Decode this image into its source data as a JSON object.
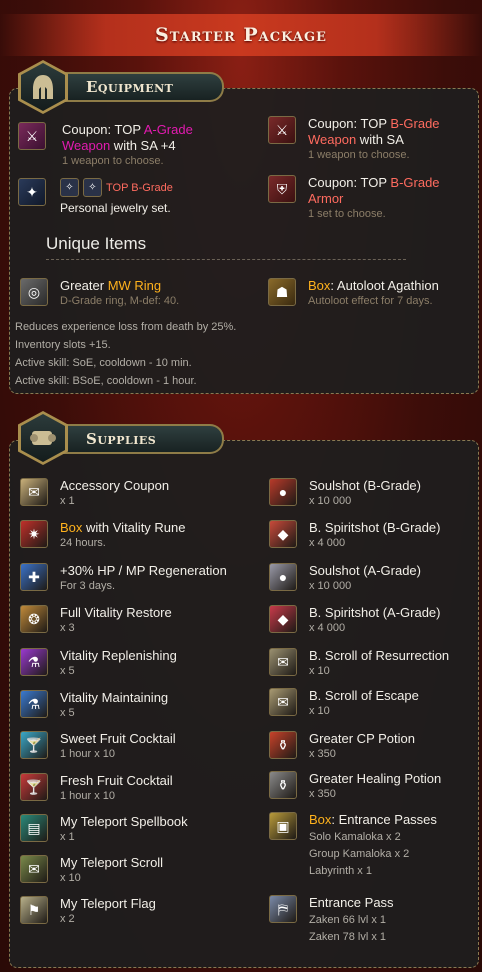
{
  "title": "Starter Package",
  "equipment": {
    "heading": "Equipment",
    "items": [
      {
        "line1_a": "Coupon: TOP ",
        "line1_b": "A-Grade",
        "line2_a": "Weapon",
        "line2_b": " with SA +4",
        "sub": "1 weapon to choose."
      },
      {
        "line1_a": "TOP B-Grade",
        "line2_a": "Personal jewelry set."
      },
      {
        "line1_a": "Coupon: TOP ",
        "line1_b": "B-Grade",
        "line2_a": "Weapon",
        "line2_b": " with SA",
        "sub": "1 weapon to choose."
      },
      {
        "line1_a": "Coupon: TOP ",
        "line1_b": "B-Grade",
        "line2_a": "Armor",
        "sub": "1 set to choose."
      }
    ],
    "unique_title": "Unique Items",
    "ring": {
      "prefix": "Greater ",
      "highlight": "MW Ring",
      "sub": "D-Grade ring, M-def: 40."
    },
    "agathion": {
      "highlight": "Box",
      "rest": ": Autoloot Agathion",
      "sub": "Autoloot effect for 7 days."
    },
    "ring_desc": [
      "Reduces experience loss from death by 25%.",
      "Inventory slots +15.",
      "Active skill: SoE, cooldown - 10 min.",
      "Active skill: BSoE, cooldown - 1 hour."
    ]
  },
  "supplies": {
    "heading": "Supplies",
    "left": [
      {
        "name": "Accessory Coupon",
        "sub": "x 1",
        "icon": "coupon-icon",
        "color": "#c9b07a"
      },
      {
        "name_hl": "Box",
        "name": " with Vitality Rune",
        "sub": "24 hours.",
        "icon": "rune-icon",
        "color": "#c0302a"
      },
      {
        "name": "+30% HP / MP Regeneration",
        "sub": "For 3 days.",
        "icon": "regen-icon",
        "color": "#3b72c8"
      },
      {
        "name": "Full Vitality Restore",
        "sub": "x 3",
        "icon": "restore-icon",
        "color": "#c08a3a"
      },
      {
        "name": "Vitality Replenishing",
        "sub": "x 5",
        "icon": "potion-purple-icon",
        "color": "#9a3ad0"
      },
      {
        "name": "Vitality Maintaining",
        "sub": "x 5",
        "icon": "potion-blue-icon",
        "color": "#3a7ad0"
      },
      {
        "name": "Sweet Fruit Cocktail",
        "sub": "1 hour x 10",
        "icon": "cocktail-icon",
        "color": "#3aa8c8"
      },
      {
        "name": "Fresh Fruit Cocktail",
        "sub": "1 hour x 10",
        "icon": "cocktail-red-icon",
        "color": "#c83a3a"
      },
      {
        "name": "My Teleport Spellbook",
        "sub": "x 1",
        "icon": "spellbook-icon",
        "color": "#2a8a7a"
      },
      {
        "name": "My Teleport Scroll",
        "sub": "x 10",
        "icon": "scroll-icon",
        "color": "#7a8a4a"
      },
      {
        "name": "My Teleport Flag",
        "sub": "x 2",
        "icon": "flag-icon",
        "color": "#b8b08a"
      }
    ],
    "right": [
      {
        "name": "Soulshot (B-Grade)",
        "sub": "x 10 000",
        "icon": "soulshot-icon",
        "color": "#b83a2a"
      },
      {
        "name": "B. Spiritshot (B-Grade)",
        "sub": "x 4 000",
        "icon": "spiritshot-icon",
        "color": "#c84a3a"
      },
      {
        "name": "Soulshot (A-Grade)",
        "sub": "x 10 000",
        "icon": "soulshot-icon",
        "color": "#9a9aa8"
      },
      {
        "name": "B. Spiritshot (A-Grade)",
        "sub": "x 4 000",
        "icon": "spiritshot-icon",
        "color": "#c83a4a"
      },
      {
        "name": "B. Scroll of Resurrection",
        "sub": "x 10",
        "icon": "scroll-resurrection-icon",
        "color": "#9a9070"
      },
      {
        "name": "B. Scroll of Escape",
        "sub": "x 10",
        "icon": "scroll-escape-icon",
        "color": "#a89a72"
      },
      {
        "name": "Greater CP Potion",
        "sub": "x 350",
        "icon": "cp-potion-icon",
        "color": "#c8422a"
      },
      {
        "name": "Greater Healing Potion",
        "sub": "x 350",
        "icon": "healing-potion-icon",
        "color": "#8a8a8a"
      },
      {
        "name_hl": "Box",
        "name": ": Entrance Passes",
        "subs": [
          "Solo Kamaloka x 2",
          "Group Kamaloka x 2",
          "Labyrinth x 1"
        ],
        "icon": "pass-box-icon",
        "color": "#b89a3a"
      },
      {
        "name": "Entrance Pass",
        "subs": [
          "Zaken 66 lvl x 1",
          "Zaken 78 lvl x 1"
        ],
        "icon": "entrance-pass-icon",
        "color": "#7a8aa8"
      }
    ]
  }
}
